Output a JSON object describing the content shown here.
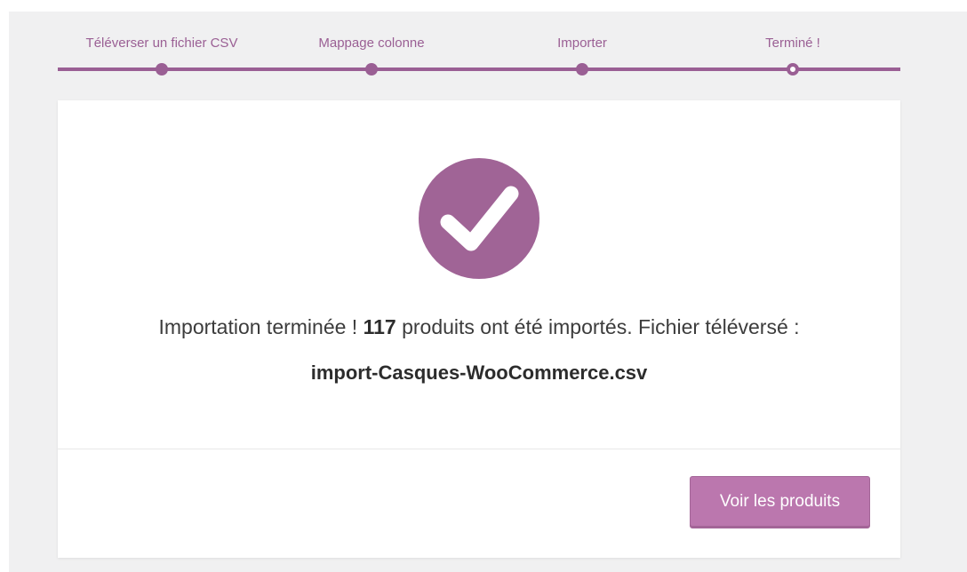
{
  "steps": [
    {
      "label": "Téléverser un fichier CSV",
      "state": "done"
    },
    {
      "label": "Mappage colonne",
      "state": "done"
    },
    {
      "label": "Importer",
      "state": "done"
    },
    {
      "label": "Terminé !",
      "state": "active"
    }
  ],
  "result": {
    "message_prefix": "Importation terminée ! ",
    "count": "117",
    "message_suffix": " produits ont été importés. Fichier téléversé :",
    "filename": "import-Casques-WooCommerce.csv"
  },
  "actions": {
    "view_products_label": "Voir les produits"
  },
  "colors": {
    "accent": "#9a5f94",
    "check_circle": "#a06496",
    "button": "#bb77ae"
  },
  "icons": {
    "success": "checkmark-icon"
  }
}
